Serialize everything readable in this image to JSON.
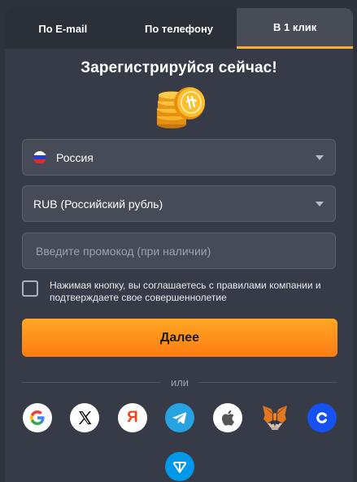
{
  "tabs": {
    "email": "По E-mail",
    "phone": "По телефону",
    "one_click": "В 1 клик"
  },
  "title": "Зарегистрируйся сейчас!",
  "country": {
    "value": "Россия"
  },
  "currency": {
    "value": "RUB (Российский рубль)"
  },
  "promo": {
    "placeholder": "Введите промокод (при наличии)"
  },
  "agreement": {
    "line1": "Нажимая кнопку, вы соглашаетесь с правилами компании и",
    "line2": "подтверждаете свое совершеннолетие"
  },
  "submit_label": "Далее",
  "divider_text": "или",
  "social": [
    "google-icon",
    "x-icon",
    "yandex-icon",
    "telegram-icon",
    "apple-icon",
    "metamask-icon",
    "coinbase-icon",
    "ton-icon"
  ],
  "yandex_letter": "Я",
  "colors": {
    "accent": "#ff9a1f",
    "active_tab_underline": "#f7b034",
    "background": "#373b47"
  }
}
